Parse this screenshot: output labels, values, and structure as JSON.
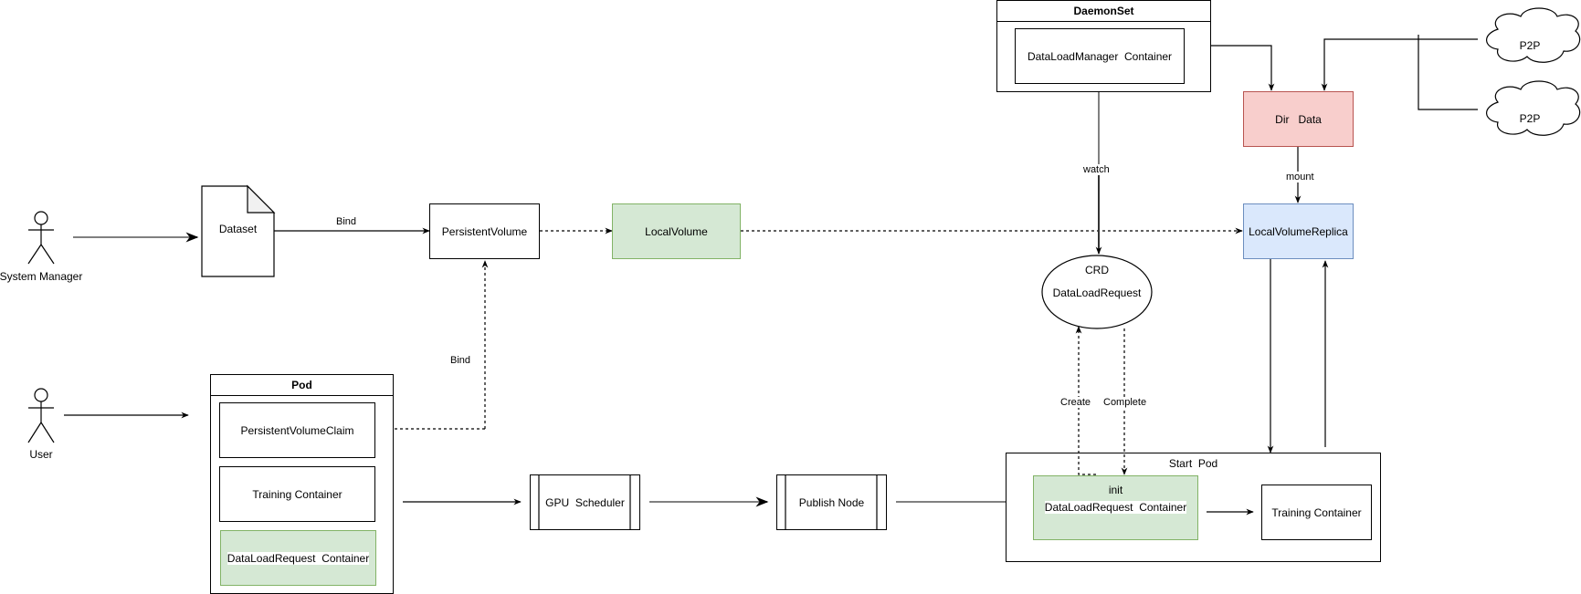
{
  "actors": {
    "system_manager": "System Manager",
    "user": "User"
  },
  "nodes": {
    "dataset": "Dataset",
    "persistent_volume": "PersistentVolume",
    "local_volume": "LocalVolume",
    "local_volume_replica": "LocalVolumeReplica",
    "dir_data": "Dir   Data",
    "p2p_1": "P2P",
    "p2p_2": "P2P",
    "crd_title": "CRD",
    "crd_name": "DataLoadRequest",
    "gpu_scheduler": "GPU  Scheduler",
    "publish_node": "Publish Node"
  },
  "daemonset": {
    "title": "DaemonSet",
    "container": "DataLoadManager  Container"
  },
  "pod": {
    "title": "Pod",
    "items": [
      "PersistentVolumeClaim",
      "Training Container",
      "DataLoadRequest  Container"
    ]
  },
  "start_pod": {
    "title": "Start  Pod",
    "init_label": "init",
    "init_container": "DataLoadRequest  Container",
    "training_container": "Training Container"
  },
  "edges": {
    "bind_dataset_pv": "Bind",
    "bind_pvc_pv": "Bind",
    "watch": "watch",
    "mount": "mount",
    "create": "Create",
    "complete": "Complete"
  },
  "colors": {
    "green_fill": "#d5e8d4",
    "green_stroke": "#82b366",
    "red_fill": "#f8cecc",
    "red_stroke": "#b85450",
    "blue_fill": "#dae8fc",
    "blue_stroke": "#6c8ebf"
  }
}
